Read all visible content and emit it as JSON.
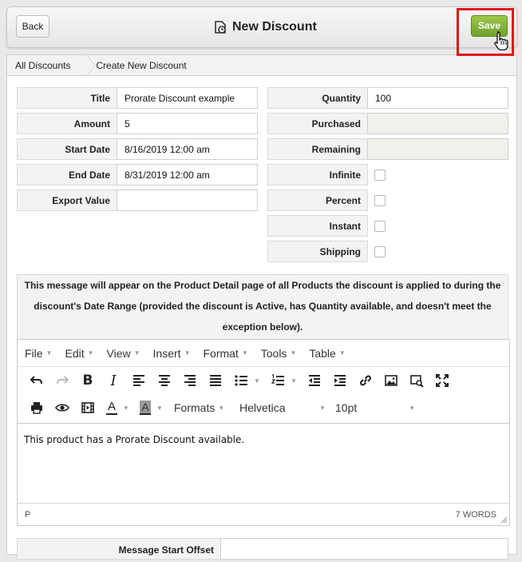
{
  "header": {
    "back_label": "Back",
    "title": "New Discount",
    "save_label": "Save",
    "save_color": "#7cae32",
    "highlight_color": "#e0161c"
  },
  "breadcrumb": {
    "items": [
      "All Discounts",
      "Create New Discount"
    ]
  },
  "form": {
    "left": [
      {
        "label": "Title",
        "value": "Prorate Discount example"
      },
      {
        "label": "Amount",
        "value": "5"
      },
      {
        "label": "Start Date",
        "value": "8/16/2019 12:00 am"
      },
      {
        "label": "End Date",
        "value": "8/31/2019 12:00 am"
      },
      {
        "label": "Export Value",
        "value": ""
      }
    ],
    "right": [
      {
        "label": "Quantity",
        "value": "100"
      },
      {
        "label": "Purchased",
        "value": ""
      },
      {
        "label": "Remaining",
        "value": ""
      },
      {
        "label": "Infinite",
        "checked": false
      },
      {
        "label": "Percent",
        "checked": false
      },
      {
        "label": "Instant",
        "checked": false
      },
      {
        "label": "Shipping",
        "checked": false
      }
    ]
  },
  "notice": "This message will appear on the Product Detail page of all Products the discount is applied to during the discount's Date Range (provided the discount is Active, has Quantity available, and doesn't meet the exception below).",
  "editor": {
    "menus": [
      "File",
      "Edit",
      "View",
      "Insert",
      "Format",
      "Tools",
      "Table"
    ],
    "toolbar_icons": [
      "undo-icon",
      "redo-icon",
      "bold-icon",
      "italic-icon",
      "align-left-icon",
      "align-center-icon",
      "align-right-icon",
      "justify-icon",
      "bullet-list-icon",
      "numbered-list-icon",
      "outdent-icon",
      "indent-icon",
      "link-icon",
      "image-icon",
      "media-icon",
      "fullscreen-icon",
      "print-icon",
      "preview-icon",
      "video-icon",
      "text-color-icon",
      "background-color-icon"
    ],
    "formats_label": "Formats",
    "font_family": "Helvetica",
    "font_size": "10pt",
    "content": "This product has a Prorate Discount available.",
    "path": "P",
    "word_count": "7 WORDS"
  },
  "offset": {
    "label": "Message Start Offset",
    "value": ""
  }
}
